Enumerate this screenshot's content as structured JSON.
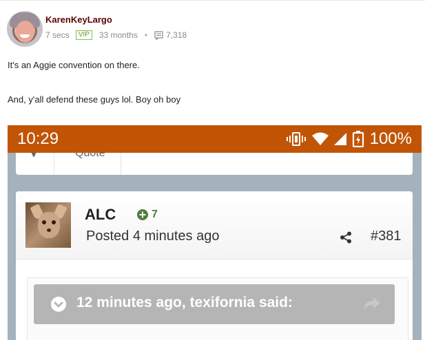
{
  "post": {
    "username": "KarenKeyLargo",
    "time": "7 secs",
    "badge": "VIP",
    "member_duration": "33 months",
    "post_count": "7,318",
    "lines": [
      "It's an Aggie convention on there.",
      "And, y'all defend these guys lol. Boy oh boy"
    ]
  },
  "embedded_screenshot": {
    "status_bar": {
      "time": "10:29",
      "battery": "100%",
      "color": "#c15505"
    },
    "top_card": {
      "quote_label": "Quote"
    },
    "post_card": {
      "author": "ALC",
      "reputation": "7",
      "posted": "Posted 4 minutes ago",
      "post_number": "#381",
      "quote_header": "12 minutes ago, texifornia said:"
    }
  },
  "colors": {
    "username": "#5a0000",
    "vip": "#5a9a2a",
    "reputation": "#4f7f3a",
    "screenshot_bg": "#a4b2bd"
  },
  "icons": [
    "message-icon",
    "vibrate-icon",
    "wifi-icon",
    "signal-icon",
    "battery-charging-icon",
    "plus-circle-icon",
    "share-icon",
    "chevron-down-icon",
    "reply-arrow-icon"
  ]
}
